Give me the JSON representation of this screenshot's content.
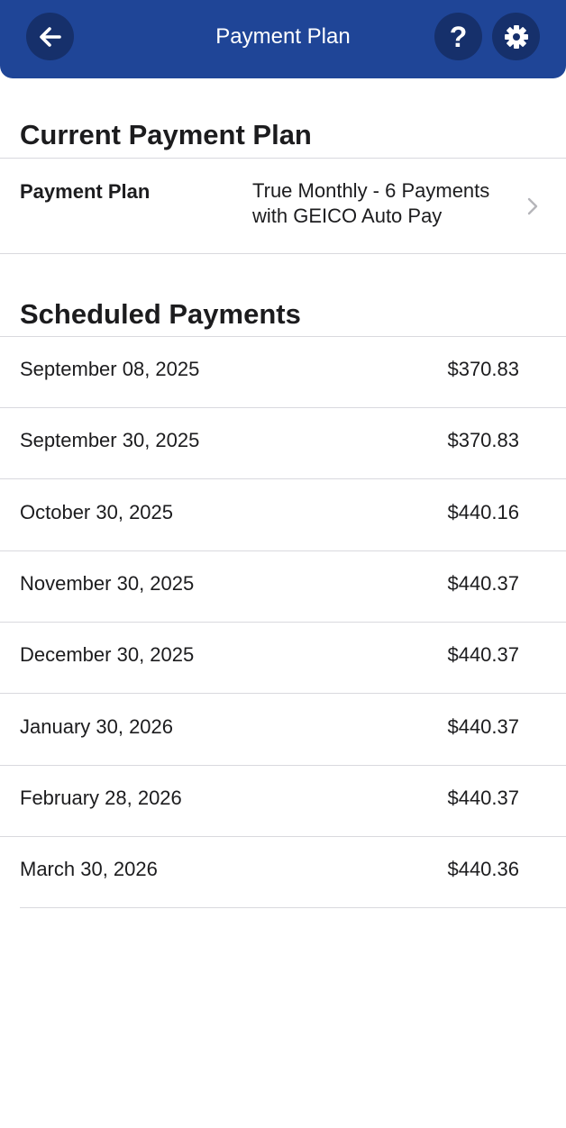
{
  "header": {
    "title": "Payment Plan",
    "back_icon": "arrow-left-icon",
    "help_icon": "question-mark-icon",
    "help_glyph": "?",
    "settings_icon": "gear-icon",
    "background_color": "#1f4597",
    "button_color": "#16306b"
  },
  "current_plan": {
    "section_title": "Current Payment Plan",
    "label": "Payment Plan",
    "value_line1": "True Monthly - 6 Payments",
    "value_line2": "with GEICO Auto Pay",
    "chevron_icon": "chevron-right-icon"
  },
  "scheduled": {
    "section_title": "Scheduled Payments",
    "payments": [
      {
        "date": "September 08, 2025",
        "amount": "$370.83"
      },
      {
        "date": "September 30, 2025",
        "amount": "$370.83"
      },
      {
        "date": "October 30, 2025",
        "amount": "$440.16"
      },
      {
        "date": "November 30, 2025",
        "amount": "$440.37"
      },
      {
        "date": "December 30, 2025",
        "amount": "$440.37"
      },
      {
        "date": "January 30, 2026",
        "amount": "$440.37"
      },
      {
        "date": "February 28, 2026",
        "amount": "$440.37"
      },
      {
        "date": "March 30, 2026",
        "amount": "$440.36"
      }
    ]
  }
}
